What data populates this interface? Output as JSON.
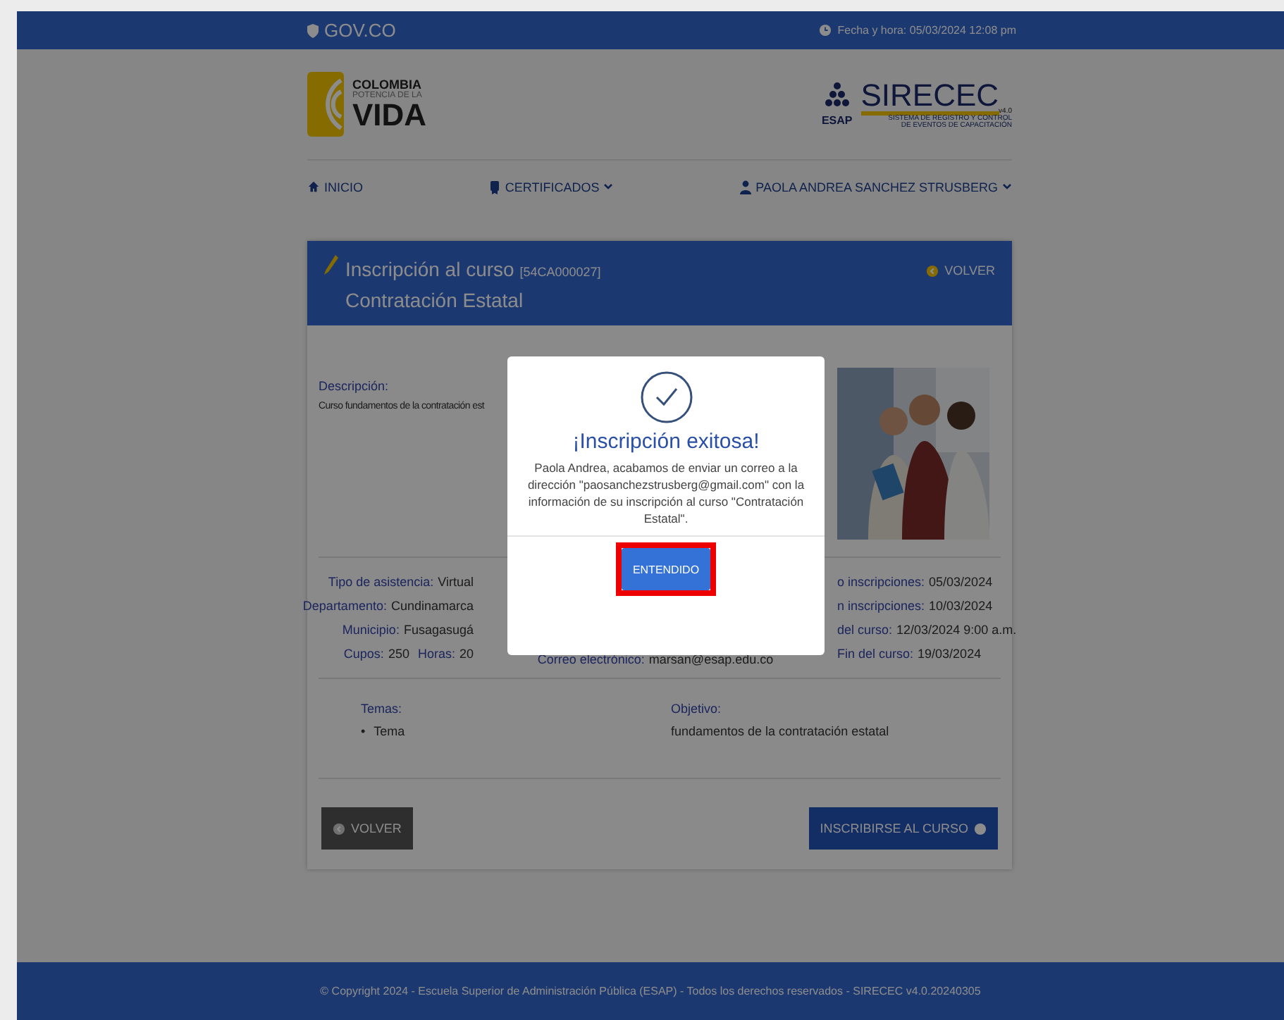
{
  "gov_bar": {
    "brand": "GOV.CO",
    "datetime": "Fecha y hora: 05/03/2024 12:08 pm"
  },
  "header": {
    "left_logo": {
      "line1": "COLOMBIA",
      "line2": "POTENCIA DE LA",
      "line3": "VIDA"
    },
    "right_logo": {
      "org": "ESAP",
      "name": "SIRECEC",
      "version": "v4.0",
      "subtitle_1": "SISTEMA DE REGISTRO Y CONTROL",
      "subtitle_2": "DE EVENTOS DE CAPACITACIÓN"
    }
  },
  "nav": [
    {
      "label": "INICIO",
      "dropdown": false
    },
    {
      "label": "CERTIFICADOS",
      "dropdown": true
    },
    {
      "label": "PAOLA ANDREA SANCHEZ STRUSBERG",
      "dropdown": true
    }
  ],
  "card": {
    "title": "Inscripción al curso",
    "code": "[54CA000027]",
    "course": "Contratación Estatal",
    "back": "VOLVER",
    "description_label": "Descripción:",
    "description": "Curso fundamentos de la contratación est",
    "image": {
      "kind": "picture"
    },
    "details_left": [
      [
        {
          "label": "Tipo de asistencia:",
          "value": "Virtual"
        }
      ],
      [
        {
          "label": "Departamento:",
          "value": "Cundinamarca"
        }
      ],
      [
        {
          "label": "Municipio:",
          "value": "Fusagasugá"
        }
      ],
      [
        {
          "label": "Cupos:",
          "value": "250"
        },
        {
          "label": "Horas:",
          "value": "20"
        }
      ]
    ],
    "details_middle": [
      [
        {
          "label": "Correo electrónico:",
          "value": "marsan@esap.edu.co"
        }
      ]
    ],
    "details_right": [
      [
        {
          "label": "o inscripciones:",
          "value": "05/03/2024"
        }
      ],
      [
        {
          "label": "n inscripciones:",
          "value": "10/03/2024"
        }
      ],
      [
        {
          "label": "del curso:",
          "value": "12/03/2024 9:00 a.m."
        }
      ],
      [
        {
          "label": "Fin del curso:",
          "value": "19/03/2024"
        }
      ]
    ],
    "topics_label": "Temas:",
    "topic_bullet": "•",
    "topics": [
      "Tema"
    ],
    "objective_label": "Objetivo:",
    "objective": "fundamentos de la contratación estatal",
    "buttons": [
      {
        "label": "VOLVER",
        "kind": "secondary"
      },
      {
        "label": "INSCRIBIRSE AL CURSO",
        "kind": "primary"
      }
    ]
  },
  "modal": {
    "title": "¡Inscripción exitosa!",
    "message": "Paola Andrea, acabamos de enviar un correo a la dirección \"paosanchezstrusberg@gmail.com\" con la información de su inscripción al curso \"Contratación Estatal\".",
    "button": "ENTENDIDO",
    "highlighted": true
  },
  "footer": "© Copyright 2024 - Escuela Superior de Administración Pública (ESAP) - Todos los derechos reservados - SIRECEC v4.0.20240305"
}
